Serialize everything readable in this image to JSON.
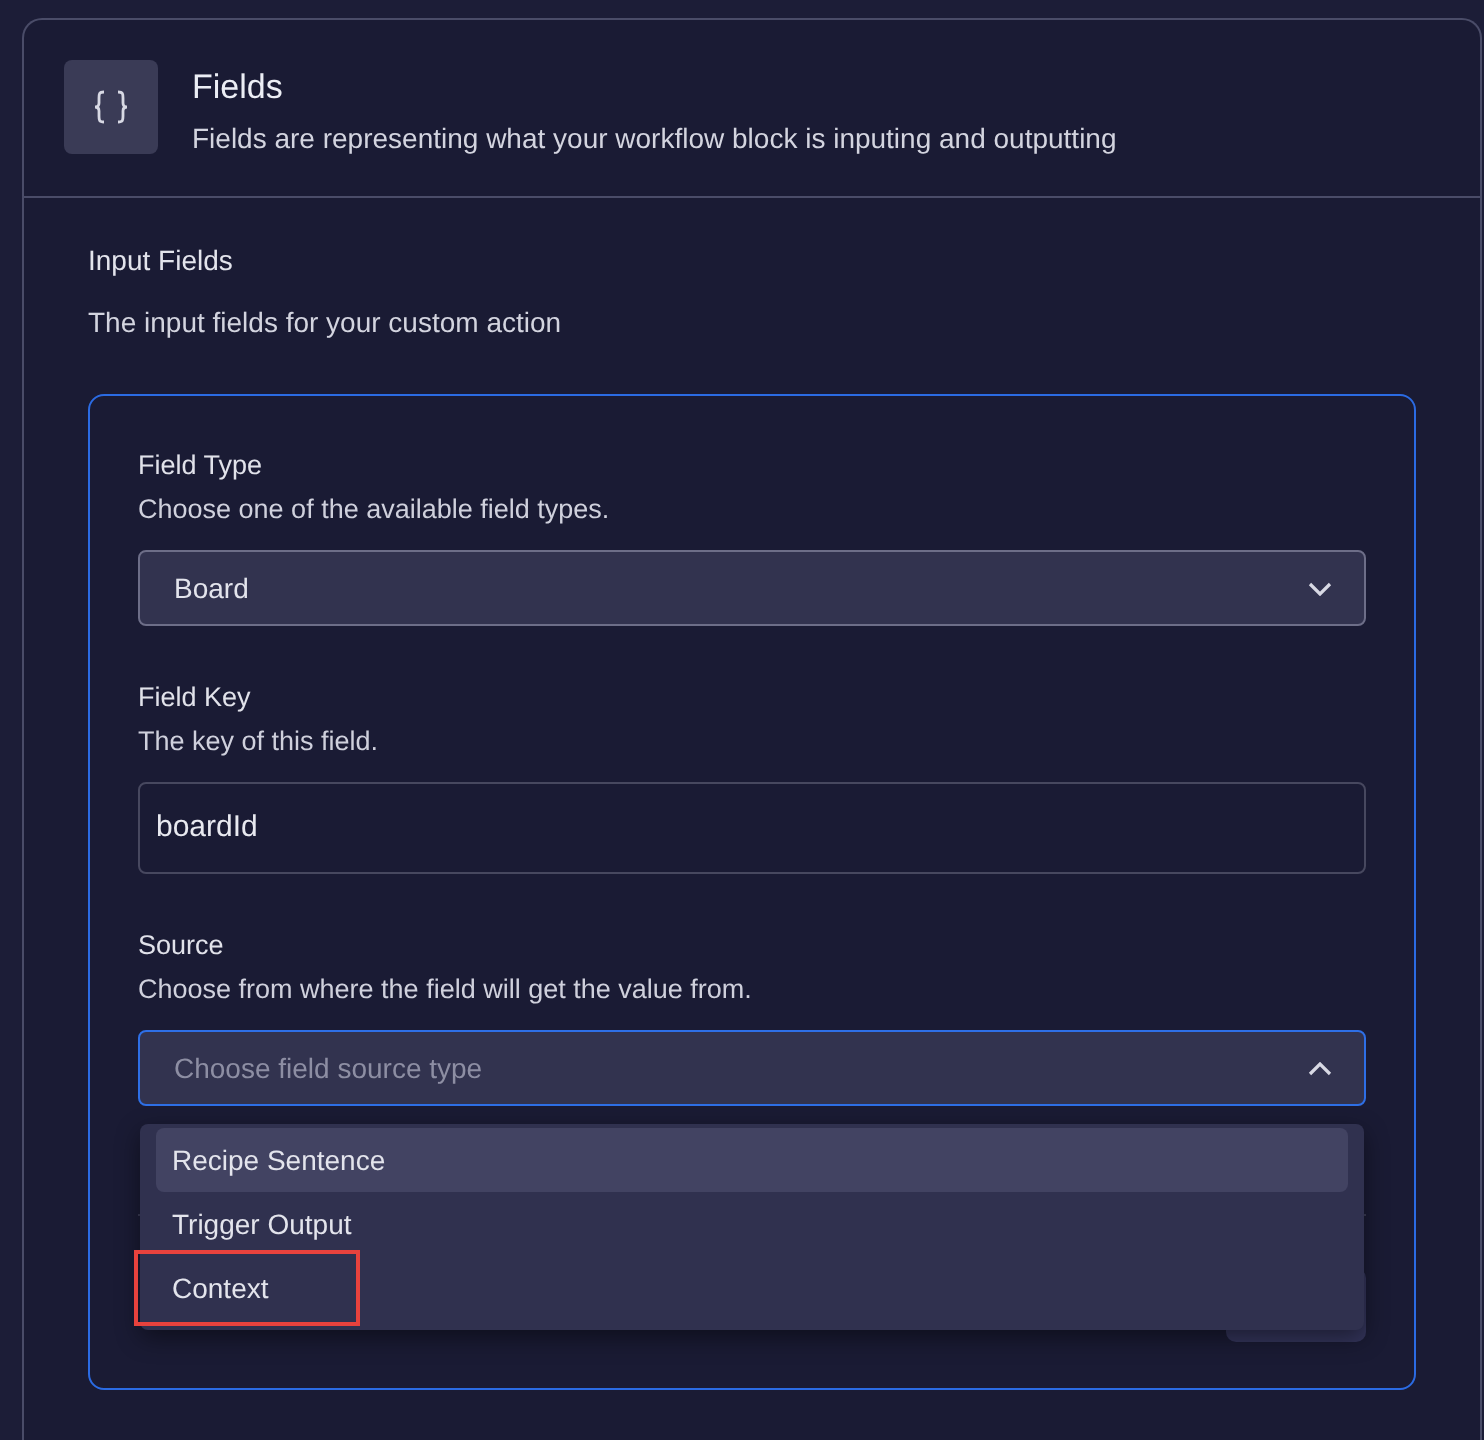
{
  "panel": {
    "title": "Fields",
    "subtitle": "Fields are representing what your workflow block is inputing and outputting"
  },
  "section": {
    "title": "Input Fields",
    "description": "The input fields for your custom action"
  },
  "fields": [
    {
      "kind": "select",
      "label": "Field Type",
      "description": "Choose one of the available field types.",
      "value": "Board",
      "expanded": false,
      "focused": false
    },
    {
      "kind": "text",
      "label": "Field Key",
      "description": "The key of this field.",
      "value": "boardId"
    },
    {
      "kind": "select",
      "label": "Source",
      "description": "Choose from where the field will get the value from.",
      "placeholder": "Choose field source type",
      "expanded": true,
      "focused": true,
      "options": [
        {
          "label": "Recipe Sentence",
          "selected": true,
          "annotated": false
        },
        {
          "label": "Trigger Output",
          "selected": false,
          "annotated": false
        },
        {
          "label": "Context",
          "selected": false,
          "annotated": true
        }
      ]
    }
  ]
}
